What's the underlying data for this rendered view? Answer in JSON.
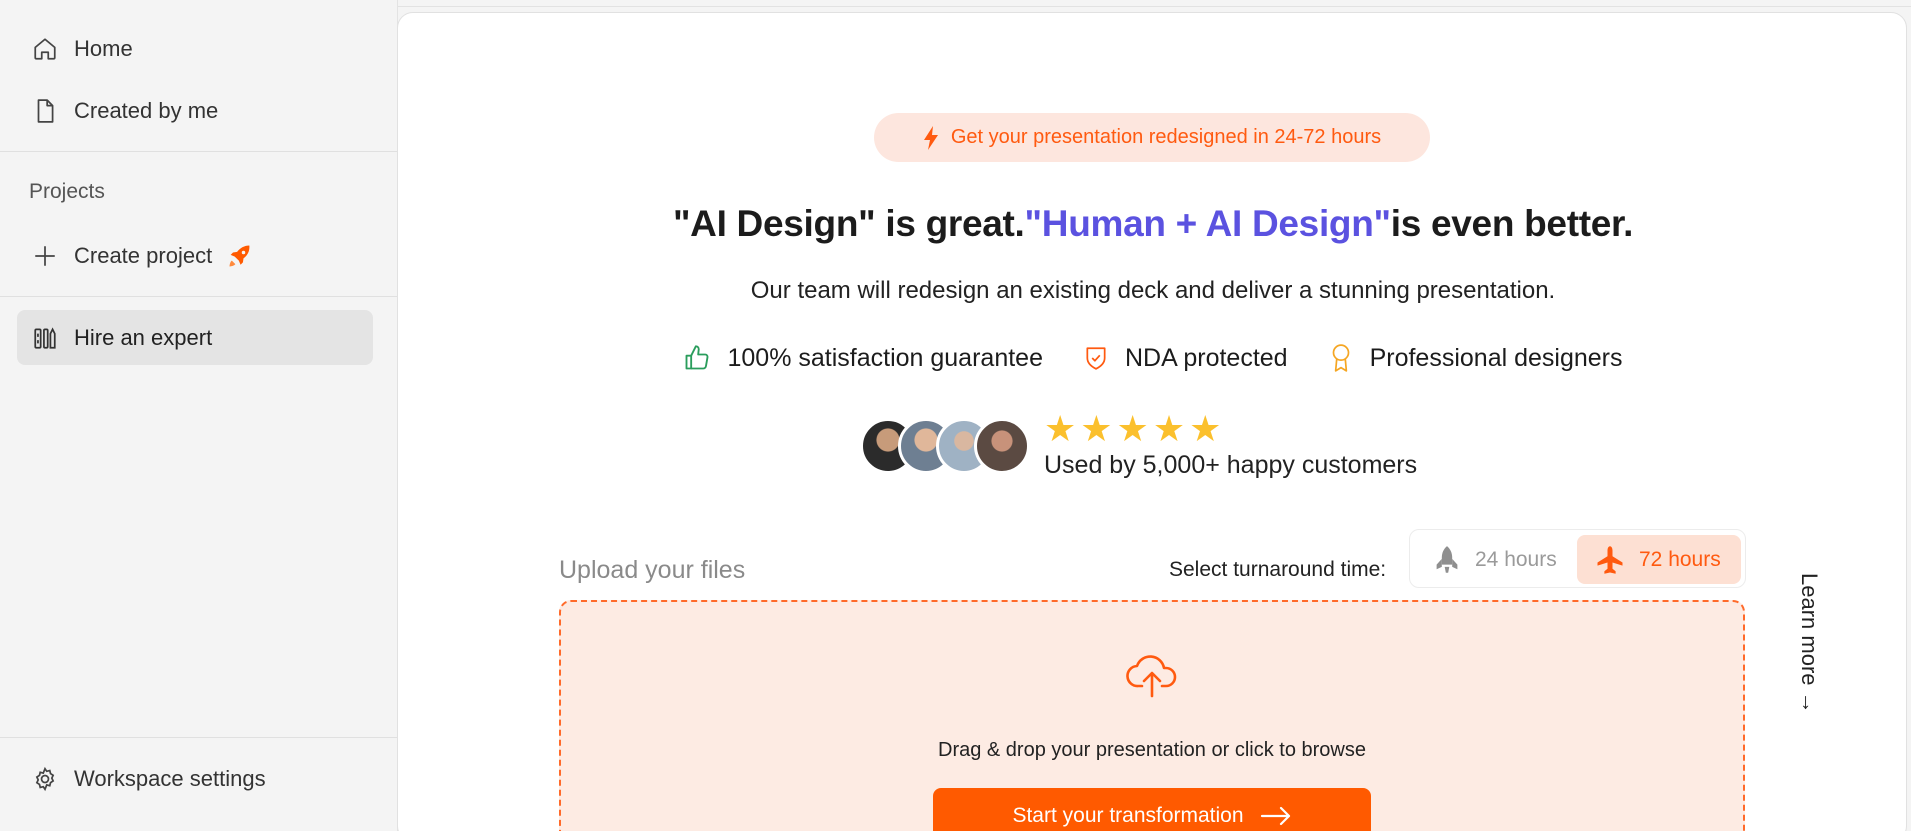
{
  "sidebar": {
    "nav": [
      {
        "label": "Home",
        "icon": "home-icon"
      },
      {
        "label": "Created by me",
        "icon": "document-icon"
      }
    ],
    "projects_label": "Projects",
    "create_project_label": "Create project",
    "hire_expert_label": "Hire an expert",
    "workspace_settings_label": "Workspace settings"
  },
  "hero": {
    "pill_text": "Get your presentation redesigned in 24-72 hours",
    "headline_part1": "\"AI Design\" is great.",
    "headline_highlight": "\"Human + AI Design\"",
    "headline_part2": "is even better.",
    "subline": "Our team will redesign an existing deck and deliver a stunning presentation.",
    "features": [
      {
        "label": "100% satisfaction guarantee",
        "icon": "thumbs-up-icon"
      },
      {
        "label": "NDA protected",
        "icon": "shield-check-icon"
      },
      {
        "label": "Professional designers",
        "icon": "award-icon"
      }
    ],
    "rating": "★★★★★",
    "customers_text": "Used by 5,000+ happy customers"
  },
  "upload": {
    "label": "Upload your files",
    "turnaround_label": "Select turnaround time:",
    "options": [
      "24 hours",
      "72 hours"
    ],
    "selected": "72 hours",
    "dropzone_text": "Drag & drop your presentation or click to browse",
    "cta_label": "Start your transformation"
  },
  "learn_more": "Learn more →",
  "colors": {
    "accent": "#ff5a00",
    "accent_soft": "#fde6de",
    "highlight": "#5b52e0",
    "star": "#fbc02d"
  }
}
